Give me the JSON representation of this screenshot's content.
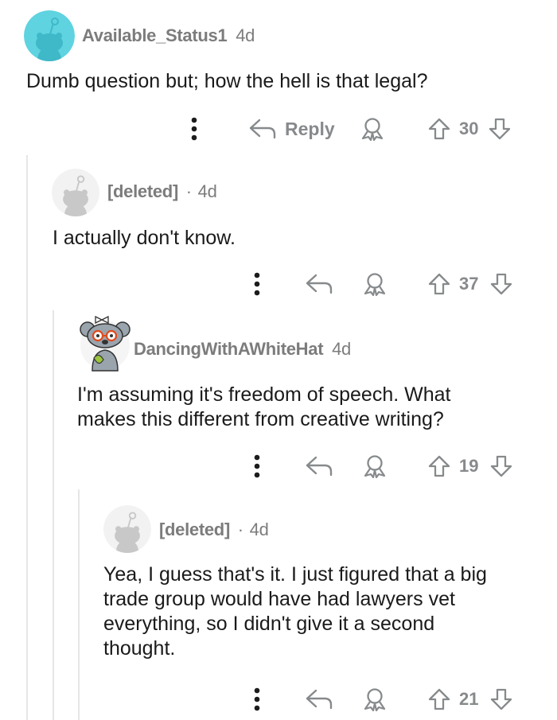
{
  "comments": [
    {
      "username": "Available_Status1",
      "age": "4d",
      "body": "Dumb question but; how the hell is that legal?",
      "reply_label": "Reply",
      "votes": "30"
    },
    {
      "username": "[deleted]",
      "separator": "·",
      "age": "4d",
      "body": "I actually don't know.",
      "votes": "37"
    },
    {
      "username": "DancingWithAWhiteHat",
      "age": "4d",
      "body": "I'm assuming it's freedom of speech. What\nmakes this different from creative writing?",
      "votes": "19"
    },
    {
      "username": "[deleted]",
      "separator": "·",
      "age": "4d",
      "body": "Yea, I guess that's it. I just figured that a big\ntrade group would have had lawyers vet\neverything, so I didn't give it a second\nthought.",
      "votes": "21"
    }
  ],
  "icons": {
    "more": "more-vertical-icon",
    "reply": "reply-arrow-icon",
    "award": "award-icon",
    "upvote": "upvote-arrow-icon",
    "downvote": "downvote-arrow-icon"
  },
  "colors": {
    "meta_text": "#7c7c7c",
    "action_gray": "#878a8c",
    "avatar_teal": "#5fd3e0",
    "avatar_gray_bg": "#f2f2f2",
    "thread_line": "#e6e6e6"
  }
}
